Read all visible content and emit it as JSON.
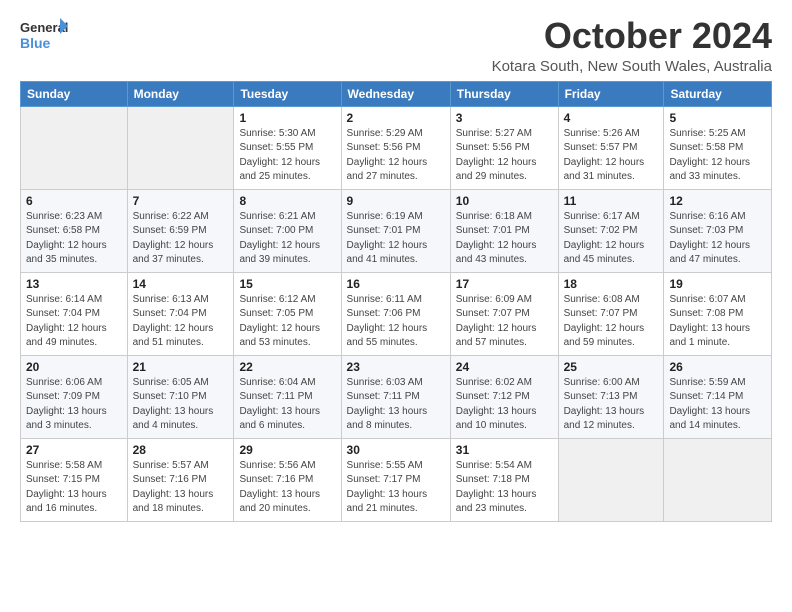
{
  "logo": {
    "line1": "General",
    "line2": "Blue"
  },
  "title": "October 2024",
  "subtitle": "Kotara South, New South Wales, Australia",
  "days_of_week": [
    "Sunday",
    "Monday",
    "Tuesday",
    "Wednesday",
    "Thursday",
    "Friday",
    "Saturday"
  ],
  "weeks": [
    [
      {
        "day": "",
        "detail": ""
      },
      {
        "day": "",
        "detail": ""
      },
      {
        "day": "1",
        "detail": "Sunrise: 5:30 AM\nSunset: 5:55 PM\nDaylight: 12 hours and 25 minutes."
      },
      {
        "day": "2",
        "detail": "Sunrise: 5:29 AM\nSunset: 5:56 PM\nDaylight: 12 hours and 27 minutes."
      },
      {
        "day": "3",
        "detail": "Sunrise: 5:27 AM\nSunset: 5:56 PM\nDaylight: 12 hours and 29 minutes."
      },
      {
        "day": "4",
        "detail": "Sunrise: 5:26 AM\nSunset: 5:57 PM\nDaylight: 12 hours and 31 minutes."
      },
      {
        "day": "5",
        "detail": "Sunrise: 5:25 AM\nSunset: 5:58 PM\nDaylight: 12 hours and 33 minutes."
      }
    ],
    [
      {
        "day": "6",
        "detail": "Sunrise: 6:23 AM\nSunset: 6:58 PM\nDaylight: 12 hours and 35 minutes."
      },
      {
        "day": "7",
        "detail": "Sunrise: 6:22 AM\nSunset: 6:59 PM\nDaylight: 12 hours and 37 minutes."
      },
      {
        "day": "8",
        "detail": "Sunrise: 6:21 AM\nSunset: 7:00 PM\nDaylight: 12 hours and 39 minutes."
      },
      {
        "day": "9",
        "detail": "Sunrise: 6:19 AM\nSunset: 7:01 PM\nDaylight: 12 hours and 41 minutes."
      },
      {
        "day": "10",
        "detail": "Sunrise: 6:18 AM\nSunset: 7:01 PM\nDaylight: 12 hours and 43 minutes."
      },
      {
        "day": "11",
        "detail": "Sunrise: 6:17 AM\nSunset: 7:02 PM\nDaylight: 12 hours and 45 minutes."
      },
      {
        "day": "12",
        "detail": "Sunrise: 6:16 AM\nSunset: 7:03 PM\nDaylight: 12 hours and 47 minutes."
      }
    ],
    [
      {
        "day": "13",
        "detail": "Sunrise: 6:14 AM\nSunset: 7:04 PM\nDaylight: 12 hours and 49 minutes."
      },
      {
        "day": "14",
        "detail": "Sunrise: 6:13 AM\nSunset: 7:04 PM\nDaylight: 12 hours and 51 minutes."
      },
      {
        "day": "15",
        "detail": "Sunrise: 6:12 AM\nSunset: 7:05 PM\nDaylight: 12 hours and 53 minutes."
      },
      {
        "day": "16",
        "detail": "Sunrise: 6:11 AM\nSunset: 7:06 PM\nDaylight: 12 hours and 55 minutes."
      },
      {
        "day": "17",
        "detail": "Sunrise: 6:09 AM\nSunset: 7:07 PM\nDaylight: 12 hours and 57 minutes."
      },
      {
        "day": "18",
        "detail": "Sunrise: 6:08 AM\nSunset: 7:07 PM\nDaylight: 12 hours and 59 minutes."
      },
      {
        "day": "19",
        "detail": "Sunrise: 6:07 AM\nSunset: 7:08 PM\nDaylight: 13 hours and 1 minute."
      }
    ],
    [
      {
        "day": "20",
        "detail": "Sunrise: 6:06 AM\nSunset: 7:09 PM\nDaylight: 13 hours and 3 minutes."
      },
      {
        "day": "21",
        "detail": "Sunrise: 6:05 AM\nSunset: 7:10 PM\nDaylight: 13 hours and 4 minutes."
      },
      {
        "day": "22",
        "detail": "Sunrise: 6:04 AM\nSunset: 7:11 PM\nDaylight: 13 hours and 6 minutes."
      },
      {
        "day": "23",
        "detail": "Sunrise: 6:03 AM\nSunset: 7:11 PM\nDaylight: 13 hours and 8 minutes."
      },
      {
        "day": "24",
        "detail": "Sunrise: 6:02 AM\nSunset: 7:12 PM\nDaylight: 13 hours and 10 minutes."
      },
      {
        "day": "25",
        "detail": "Sunrise: 6:00 AM\nSunset: 7:13 PM\nDaylight: 13 hours and 12 minutes."
      },
      {
        "day": "26",
        "detail": "Sunrise: 5:59 AM\nSunset: 7:14 PM\nDaylight: 13 hours and 14 minutes."
      }
    ],
    [
      {
        "day": "27",
        "detail": "Sunrise: 5:58 AM\nSunset: 7:15 PM\nDaylight: 13 hours and 16 minutes."
      },
      {
        "day": "28",
        "detail": "Sunrise: 5:57 AM\nSunset: 7:16 PM\nDaylight: 13 hours and 18 minutes."
      },
      {
        "day": "29",
        "detail": "Sunrise: 5:56 AM\nSunset: 7:16 PM\nDaylight: 13 hours and 20 minutes."
      },
      {
        "day": "30",
        "detail": "Sunrise: 5:55 AM\nSunset: 7:17 PM\nDaylight: 13 hours and 21 minutes."
      },
      {
        "day": "31",
        "detail": "Sunrise: 5:54 AM\nSunset: 7:18 PM\nDaylight: 13 hours and 23 minutes."
      },
      {
        "day": "",
        "detail": ""
      },
      {
        "day": "",
        "detail": ""
      }
    ]
  ]
}
